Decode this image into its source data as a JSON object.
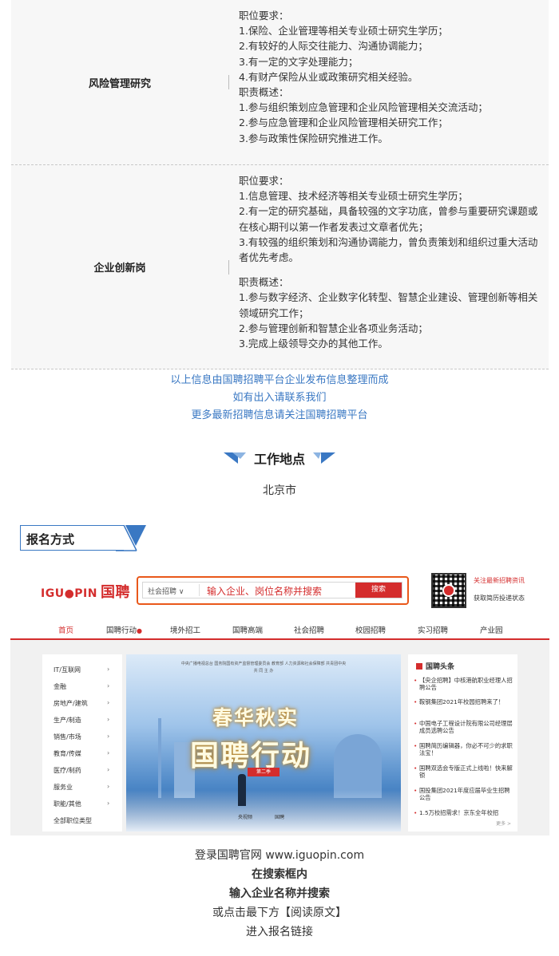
{
  "jobs": [
    {
      "title": "风险管理研究",
      "lines": [
        "职位要求：",
        "1.保险、企业管理等相关专业硕士研究生学历；",
        "2.有较好的人际交往能力、沟通协调能力；",
        "3.有一定的文字处理能力；",
        "4.有财产保险从业或政策研究相关经验。",
        "职责概述：",
        "1.参与组织策划应急管理和企业风险管理相关交流活动；",
        "2.参与应急管理和企业风险管理相关研究工作；",
        "3.参与政策性保险研究推进工作。"
      ]
    },
    {
      "title": "企业创新岗",
      "lines": [
        "职位要求：",
        "1.信息管理、技术经济等相关专业硕士研究生学历；",
        "2.有一定的研究基础，具备较强的文字功底，曾参与重要研究课题或在核心期刊以第一作者发表过文章者优先；",
        "3.有较强的组织策划和沟通协调能力，曾负责策划和组织过重大活动者优先考虑。",
        "",
        "职责概述：",
        "1.参与数字经济、企业数字化转型、智慧企业建设、管理创新等相关领域研究工作；",
        "2.参与管理创新和智慧企业各项业务活动；",
        "3.完成上级领导交办的其他工作。"
      ]
    }
  ],
  "notes": [
    "以上信息由国聘招聘平台企业发布信息整理而成",
    "如有出入请联系我们",
    "更多最新招聘信息请关注国聘招聘平台"
  ],
  "location": {
    "heading": "工作地点",
    "city": "北京市"
  },
  "register": {
    "heading": "报名方式"
  },
  "screenshot": {
    "logo_latin": "IGU●PIN",
    "logo_cn": "国聘",
    "search_category": "社会招聘 ∨",
    "search_placeholder": "输入企业、岗位名称并搜索",
    "search_button": "搜索",
    "qr_text_1": "关注最新招聘资讯",
    "qr_text_2": "获取简历投递状态",
    "nav": [
      "首页",
      "国聘行动",
      "境外招工",
      "国聘高端",
      "社会招聘",
      "校园招聘",
      "实习招聘",
      "产业园"
    ],
    "menu": [
      "IT/互联网",
      "金融",
      "房地产/建筑",
      "生产/制造",
      "销售/市场",
      "教育/传媒",
      "医疗/制药",
      "服务业",
      "职能/其他",
      "全部职位类型"
    ],
    "banner_header": "中央广播电视总台   国务院国有资产监督管理委员会   教育部   人力资源和社会保障部   共青团中央",
    "banner_header2": "共 同 主 办",
    "banner_title_1": "春华秋实",
    "banner_title_2": "国聘行动",
    "banner_tag": "第二季",
    "banner_foot_1": "央视频",
    "banner_foot_2": "国聘",
    "news_heading": "国聘头条",
    "news": [
      "【央企招聘】中核港航职业经理人招聘公告",
      "鞍钢集团2021年校园招聘来了！",
      "中国电子工程设计院有限公司经理层成员选聘公告",
      "国聘简历编辑器，你必不可少的求职法宝！",
      "国聘双选会专版正式上线啦！快来解锁",
      "国投集团2021年度应届毕业生招聘公告",
      "1.5万校招需求！京东全年校招"
    ],
    "news_more": "更多 >"
  },
  "instructions": {
    "line1": "登录国聘官网 www.iguopin.com",
    "line2": "在搜索框内",
    "line3": "输入企业名称并搜索",
    "line4": "或点击最下方【阅读原文】",
    "line5": "进入报名链接"
  },
  "colors": {
    "accent": "#3a78c3",
    "brand_red": "#d42d2d",
    "search_border": "#e9581a"
  }
}
